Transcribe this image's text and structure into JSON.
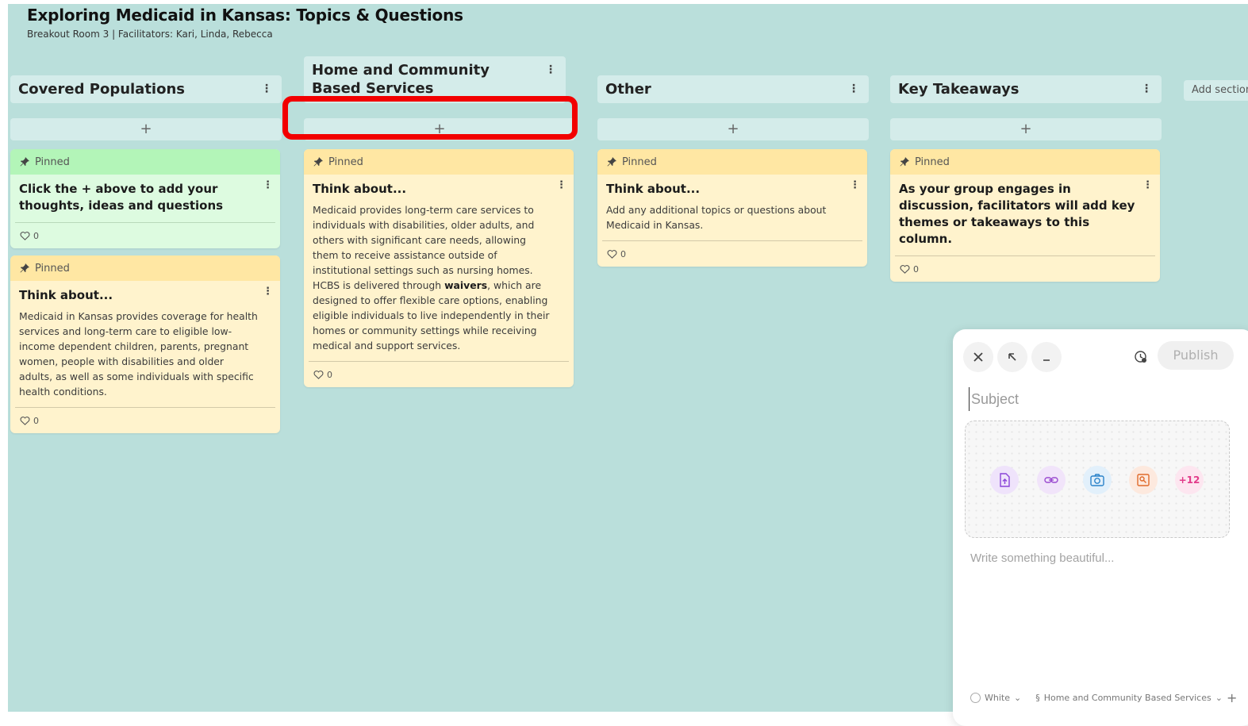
{
  "board": {
    "title": "Exploring Medicaid in Kansas: Topics & Questions",
    "subtitle": "Breakout Room 3 | Facilitators: Kari, Linda, Rebecca",
    "add_section_label": "Add section"
  },
  "columns": [
    {
      "title": "Covered Populations",
      "add_symbol": "+",
      "cards": [
        {
          "pinned_label": "Pinned",
          "title": "Click the + above to add your thoughts, ideas and questions",
          "likes": "0"
        },
        {
          "pinned_label": "Pinned",
          "title": "Think about...",
          "body": "Medicaid in Kansas provides coverage for health services and long-term care to eligible low-income dependent children, parents, pregnant women, people with disabilities and older adults, as well as some individuals with specific health conditions.",
          "likes": "0"
        }
      ]
    },
    {
      "title": "Home and Community Based Services",
      "add_symbol": "+",
      "cards": [
        {
          "pinned_label": "Pinned",
          "title": "Think about...",
          "body_before": "Medicaid provides long-term care services to individuals with disabilities, older adults, and others with significant care needs, allowing them to receive assistance outside of institutional settings such as nursing homes. HCBS is delivered through ",
          "body_bold": "waivers",
          "body_after": ", which are designed to offer flexible care options, enabling eligible individuals to live independently in their homes or community settings while receiving medical and support services.",
          "likes": "0"
        }
      ]
    },
    {
      "title": "Other",
      "add_symbol": "+",
      "cards": [
        {
          "pinned_label": "Pinned",
          "title": "Think about...",
          "body": "Add any additional topics or questions about Medicaid in Kansas.",
          "likes": "0"
        }
      ]
    },
    {
      "title": "Key Takeaways",
      "add_symbol": "+",
      "cards": [
        {
          "pinned_label": "Pinned",
          "title": "As your group engages in discussion, facilitators will add key themes or takeaways to this column.",
          "likes": "0"
        }
      ]
    }
  ],
  "composer": {
    "publish_label": "Publish",
    "subject_placeholder": "Subject",
    "body_placeholder": "Write something beautiful...",
    "more_attachments": "+12",
    "color_label": "White",
    "section_label": "Home and Community Based Services",
    "section_symbol": "§",
    "plus_symbol": "+"
  },
  "colors": {
    "board_bg": "#badfdb",
    "header_bg": "#d4ecea",
    "green_card": "#ddfbe0",
    "yellow_card": "#fff3cd",
    "highlight": "#f20000"
  }
}
